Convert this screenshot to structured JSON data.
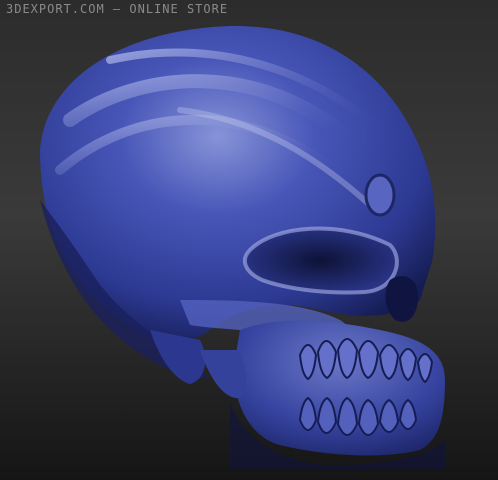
{
  "watermark": {
    "text": "3DEXPORT.COM – ONLINE STORE"
  },
  "scene": {
    "subject_icon": "skull-model-icon",
    "colors": {
      "model_base": "#3b4aa8",
      "model_shadow": "#1c2466",
      "model_highlight": "#a5b0e6",
      "background_top": "#2c2c2c",
      "background_bottom": "#151515"
    }
  }
}
